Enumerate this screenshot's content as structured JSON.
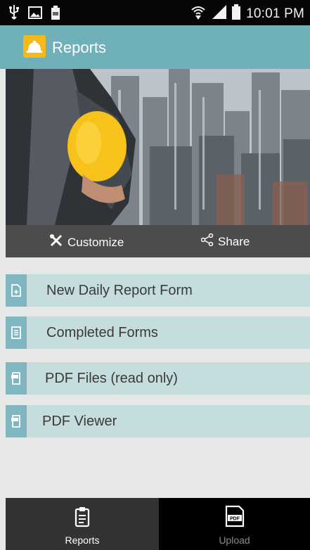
{
  "status_bar": {
    "time": "10:01 PM",
    "left_icons": [
      "usb-icon",
      "image-icon",
      "battery-saver-icon"
    ],
    "right_icons": [
      "wifi-icon",
      "signal-icon",
      "battery-icon"
    ]
  },
  "app_bar": {
    "title": "Reports",
    "logo_icon": "hardhat-logo-icon"
  },
  "hero": {
    "image_alt": "Worker holding yellow hard hat over city skyline",
    "actions": [
      {
        "label": "Customize",
        "icon": "tools-icon"
      },
      {
        "label": "Share",
        "icon": "share-icon"
      }
    ]
  },
  "menu": {
    "items": [
      {
        "label": "New Daily Report Form",
        "icon": "new-form-icon"
      },
      {
        "label": "Completed Forms",
        "icon": "completed-forms-icon"
      },
      {
        "label": "PDF Files (read only)",
        "icon": "pdf-file-icon"
      },
      {
        "label": "PDF Viewer",
        "icon": "pdf-viewer-icon"
      }
    ]
  },
  "tabs": [
    {
      "label": "Reports",
      "icon": "clipboard-icon",
      "selected": true
    },
    {
      "label": "Upload",
      "icon": "pdf-upload-icon",
      "selected": false
    }
  ],
  "colors": {
    "app_bar": "#6fb0b9",
    "row_bg": "#c5dddd",
    "row_icon_bg": "#7fb6bf",
    "action_bar": "#4c4c4c",
    "tab_selected_bg": "#333333",
    "tab_bg": "#000000"
  }
}
